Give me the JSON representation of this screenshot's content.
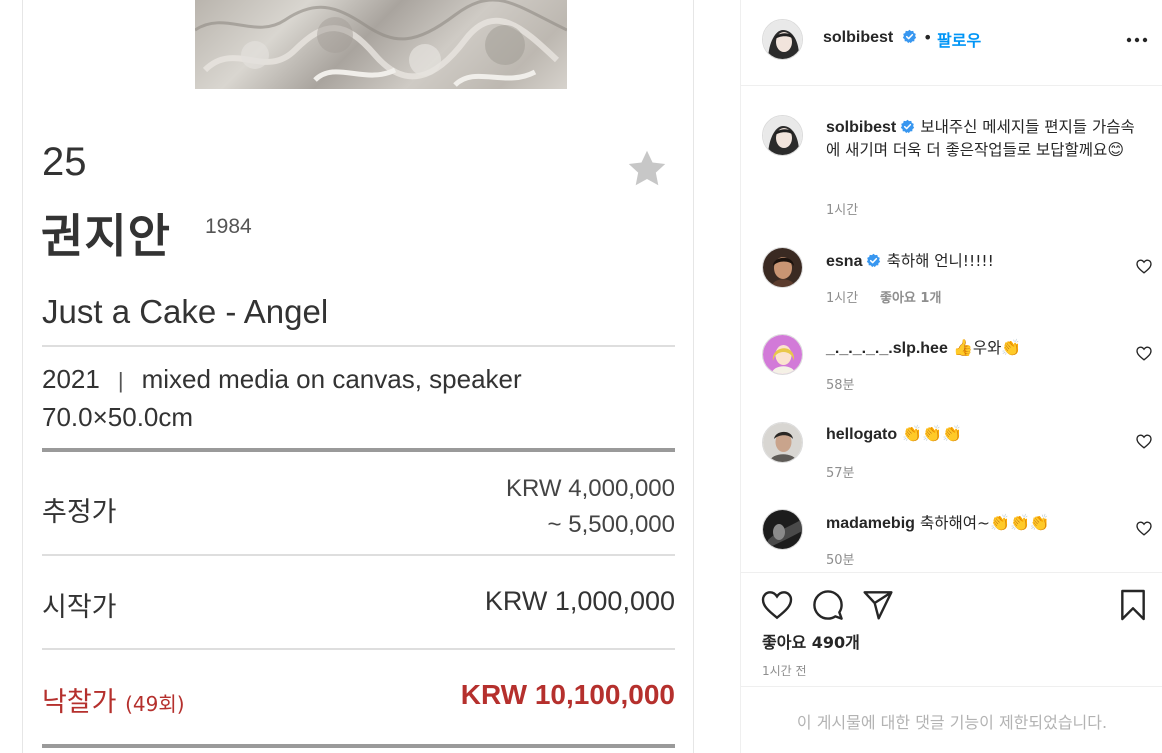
{
  "post_image": {
    "lot_number": "25",
    "artist_name": "권지안",
    "artist_year": "1984",
    "work_title": "Just a Cake - Angel",
    "work_year": "2021",
    "work_separator": "|",
    "work_medium": "mixed media on canvas, speaker",
    "work_size": "70.0×50.0cm",
    "estimate_label": "추정가",
    "estimate_line1": "KRW 4,000,000",
    "estimate_line2": "~ 5,500,000",
    "start_label": "시작가",
    "start_value": "KRW 1,000,000",
    "hammer_label": "낙찰가",
    "hammer_count": "(49회)",
    "hammer_value": "KRW 10,100,000",
    "accent_color": "#b5302d"
  },
  "header": {
    "username": "solbibest",
    "dot": "•",
    "follow_label": "팔로우"
  },
  "caption": {
    "username": "solbibest",
    "text": "보내주신 메세지들 편지들 가슴속에 새기며 더욱 더 좋은작업들로 보답할께요",
    "emoji": "😊",
    "time": "1시간"
  },
  "comments": [
    {
      "username": "esna",
      "verified": true,
      "text": "축하해 언니!!!!!",
      "emoji": "",
      "time": "1시간",
      "likes": "좋아요 1개"
    },
    {
      "username": "_._._._._.slp.hee",
      "verified": false,
      "text": "우와",
      "emoji_before": "👍",
      "emoji": "👏",
      "time": "58분",
      "likes": ""
    },
    {
      "username": "hellogato",
      "verified": false,
      "text": "",
      "emoji": "👏👏👏",
      "time": "57분",
      "likes": ""
    },
    {
      "username": "madamebig",
      "verified": false,
      "text": "축하해여~",
      "emoji": "👏👏👏",
      "time": "50분",
      "likes": ""
    }
  ],
  "actions": {
    "likes_label": "좋아요 490개",
    "post_time": "1시간 전"
  },
  "footer": {
    "comments_disabled": "이 게시물에 대한 댓글 기능이 제한되었습니다."
  },
  "colors": {
    "link_blue": "#0095f6",
    "verified_blue": "#3897f0",
    "text_dark": "#262626",
    "text_muted": "#8e8e8e"
  }
}
